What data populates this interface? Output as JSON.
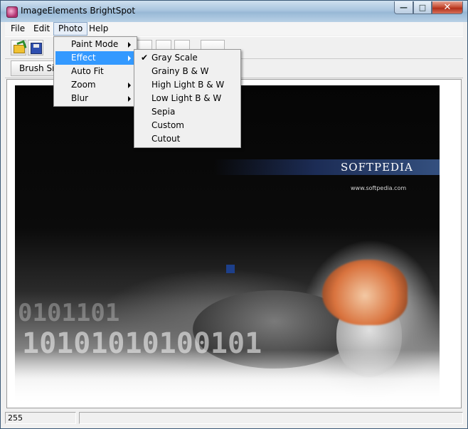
{
  "window": {
    "title": "ImageElements BrightSpot"
  },
  "menubar": {
    "items": [
      "File",
      "Edit",
      "Photo",
      "Help"
    ]
  },
  "photo_menu": {
    "items": [
      {
        "label": "Paint Mode",
        "submenu": true
      },
      {
        "label": "Effect",
        "submenu": true,
        "highlighted": true
      },
      {
        "label": "Auto Fit",
        "submenu": false
      },
      {
        "label": "Zoom",
        "submenu": true
      },
      {
        "label": "Blur",
        "submenu": true
      }
    ]
  },
  "effect_menu": {
    "items": [
      {
        "label": "Gray Scale",
        "checked": true
      },
      {
        "label": "Grainy B & W",
        "checked": false
      },
      {
        "label": "High Light B & W",
        "checked": false
      },
      {
        "label": "Low Light B & W",
        "checked": false
      },
      {
        "label": "Sepia",
        "checked": false
      },
      {
        "label": "Custom",
        "checked": false
      },
      {
        "label": "Cutout",
        "checked": false
      }
    ],
    "check_glyph": "✔"
  },
  "toolbar2": {
    "brush_size_label": "Brush Size"
  },
  "image": {
    "logo_text": "SOFTPEDIA",
    "logo_url": "www.softpedia.com",
    "digits_row1": "0101101",
    "digits_row2": "10101010100101"
  },
  "statusbar": {
    "value": "255"
  },
  "icons": {
    "minimize": "minimize-icon",
    "maximize": "maximize-icon",
    "close": "close-icon"
  }
}
